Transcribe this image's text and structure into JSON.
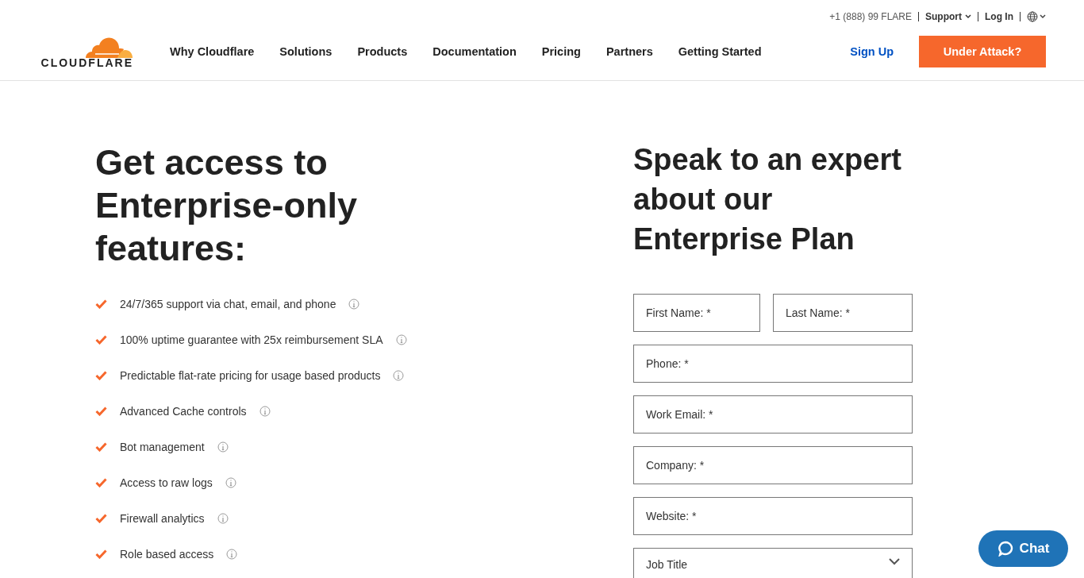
{
  "utility_bar": {
    "phone": "+1 (888) 99 FLARE",
    "support": "Support",
    "login": "Log In"
  },
  "header": {
    "logo": "CLOUDFLARE",
    "nav": [
      "Why Cloudflare",
      "Solutions",
      "Products",
      "Documentation",
      "Pricing",
      "Partners",
      "Getting Started"
    ],
    "sign_up": "Sign Up",
    "under_attack": "Under Attack?"
  },
  "features": {
    "heading": "Get access to Enterprise-only features:",
    "items": [
      "24/7/365 support via chat, email, and phone",
      "100% uptime guarantee with 25x reimbursement SLA",
      "Predictable flat-rate pricing for usage based products",
      "Advanced Cache controls",
      "Bot management",
      "Access to raw logs",
      "Firewall analytics",
      "Role based access"
    ]
  },
  "form": {
    "heading": "Speak to an expert about our Enterprise Plan",
    "fields": [
      {
        "kind": "half",
        "placeholder": "First Name: *"
      },
      {
        "kind": "half",
        "placeholder": "Last Name: *"
      },
      {
        "kind": "full",
        "placeholder": "Phone: *"
      },
      {
        "kind": "full",
        "placeholder": "Work Email: *"
      },
      {
        "kind": "full",
        "placeholder": "Company: *"
      },
      {
        "kind": "full",
        "placeholder": "Website: *"
      },
      {
        "kind": "select",
        "placeholder": "Job Title"
      }
    ]
  },
  "chat": {
    "label": "Chat"
  }
}
